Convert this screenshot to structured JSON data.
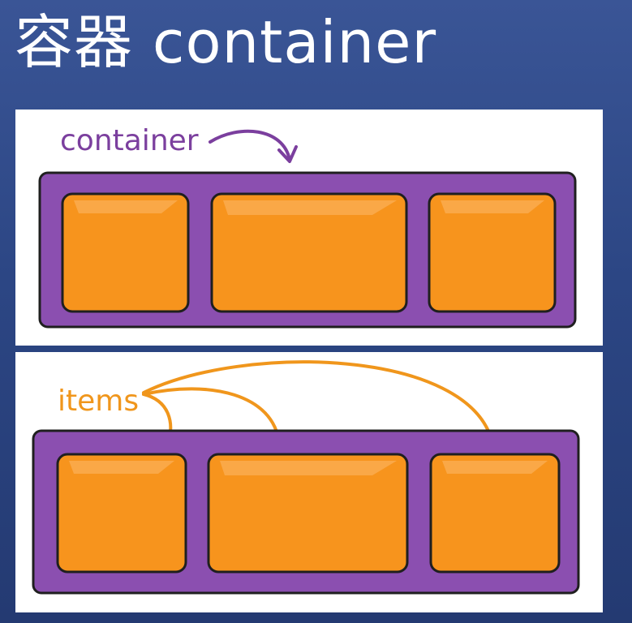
{
  "slide": {
    "title": "容器 container"
  },
  "diagram_top": {
    "label": "container",
    "item_count": 3
  },
  "diagram_bottom": {
    "label": "items",
    "item_count": 3
  },
  "colors": {
    "background": "#2c4684",
    "panel": "#ffffff",
    "container_fill": "#8b4fb0",
    "container_label": "#7b3f9e",
    "item_fill": "#f7941d",
    "item_highlight": "#fbb15a",
    "items_label": "#f0961c",
    "outline": "#1f1f1f"
  }
}
